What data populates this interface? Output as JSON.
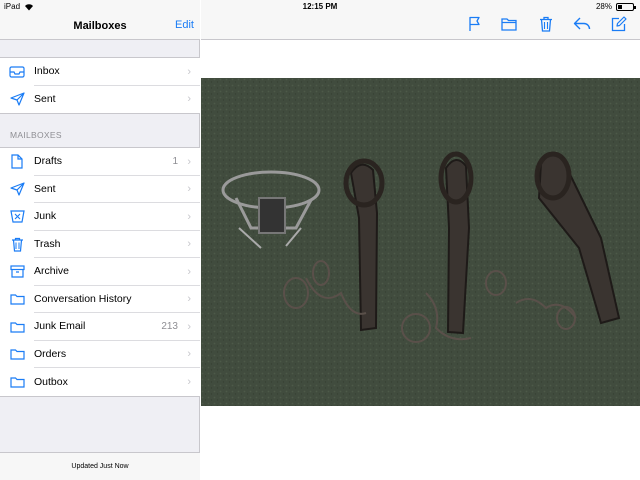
{
  "status": {
    "device": "iPad",
    "time": "12:15 PM",
    "battery": "28%",
    "battery_level": 0.28
  },
  "sidebar": {
    "title": "Mailboxes",
    "edit_label": "Edit",
    "top_items": [
      {
        "label": "Inbox",
        "icon": "inbox-tray-icon"
      },
      {
        "label": "Sent",
        "icon": "paper-plane-icon"
      }
    ],
    "section_title": "MAILBOXES",
    "items": [
      {
        "label": "Drafts",
        "icon": "document-icon",
        "count": "1"
      },
      {
        "label": "Sent",
        "icon": "paper-plane-icon",
        "count": ""
      },
      {
        "label": "Junk",
        "icon": "junk-bin-icon",
        "count": ""
      },
      {
        "label": "Trash",
        "icon": "trash-icon",
        "count": ""
      },
      {
        "label": "Archive",
        "icon": "archive-box-icon",
        "count": ""
      },
      {
        "label": "Conversation History",
        "icon": "folder-icon",
        "count": ""
      },
      {
        "label": "Junk Email",
        "icon": "folder-icon",
        "count": "213"
      },
      {
        "label": "Orders",
        "icon": "folder-icon",
        "count": ""
      },
      {
        "label": "Outbox",
        "icon": "folder-icon",
        "count": ""
      }
    ],
    "footer": "Updated Just Now"
  },
  "toolbar": {
    "icons": [
      "flag-icon",
      "folder-icon",
      "trash-icon",
      "reply-icon",
      "compose-icon"
    ]
  },
  "colors": {
    "accent": "#1a7cf5",
    "sidebar_bg": "#efeff4",
    "photo_bg": "#3f4a3c"
  }
}
